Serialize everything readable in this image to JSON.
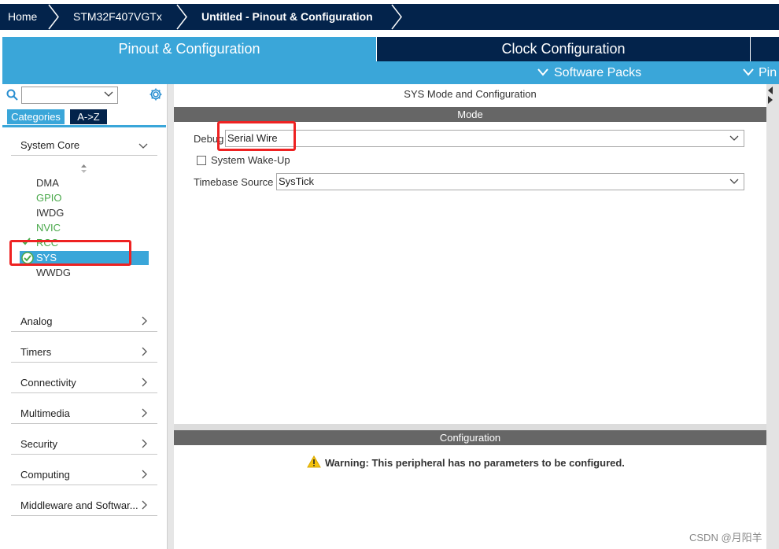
{
  "breadcrumb": {
    "home": "Home",
    "device": "STM32F407VGTx",
    "current": "Untitled - Pinout & Configuration"
  },
  "main_tabs": {
    "pinout": "Pinout & Configuration",
    "clock": "Clock Configuration"
  },
  "subbar": {
    "software_packs": "Software Packs",
    "pinout": "Pin"
  },
  "sidebar": {
    "search_value": "",
    "tabs": {
      "categories": "Categories",
      "az": "A->Z"
    },
    "system_core": {
      "label": "System Core",
      "items": [
        "DMA",
        "GPIO",
        "IWDG",
        "NVIC",
        "RCC",
        "SYS",
        "WWDG"
      ]
    },
    "categories": [
      "Analog",
      "Timers",
      "Connectivity",
      "Multimedia",
      "Security",
      "Computing",
      "Middleware and Softwar..."
    ]
  },
  "mode_panel": {
    "title": "SYS Mode and Configuration",
    "mode_header": "Mode",
    "debug_label": "Debug",
    "debug_value": "Serial Wire",
    "wakeup_label": "System Wake-Up",
    "timebase_label": "Timebase Source",
    "timebase_value": "SysTick"
  },
  "config_panel": {
    "header": "Configuration",
    "warning": "Warning: This peripheral has no parameters to be configured."
  },
  "watermark": "CSDN @月阳羊",
  "colors": {
    "navy": "#03234b",
    "accent": "#3aa6d9",
    "green_text": "#49a84a",
    "highlight_red": "#ee2222"
  }
}
